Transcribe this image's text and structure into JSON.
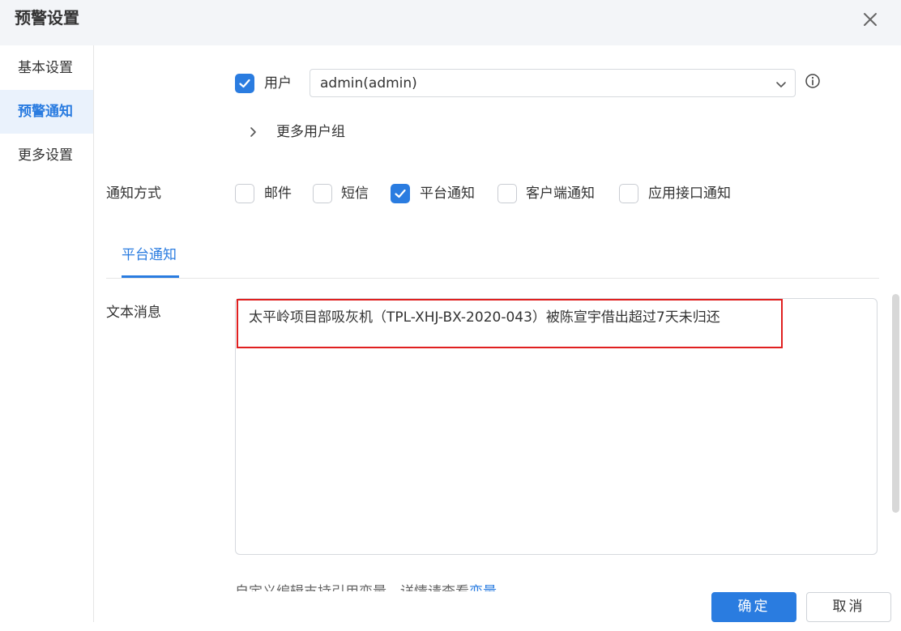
{
  "dialog": {
    "title": "预警设置"
  },
  "sidebar": {
    "items": [
      {
        "label": "基本设置"
      },
      {
        "label": "预警通知"
      },
      {
        "label": "更多设置"
      }
    ]
  },
  "recipients": {
    "user_label": "用户",
    "user_checked": true,
    "user_select_value": "admin(admin)",
    "more_groups_label": "更多用户组"
  },
  "notify": {
    "label": "通知方式",
    "options": [
      {
        "label": "邮件",
        "checked": false
      },
      {
        "label": "短信",
        "checked": false
      },
      {
        "label": "平台通知",
        "checked": true
      },
      {
        "label": "客户端通知",
        "checked": false
      },
      {
        "label": "应用接口通知",
        "checked": false
      }
    ]
  },
  "tabs": {
    "active": "平台通知"
  },
  "message": {
    "label": "文本消息",
    "text": "太平岭项目部吸灰机（TPL-XHJ-BX-2020-043）被陈宣宇借出超过7天未归还"
  },
  "hint": {
    "text": "自定义编辑支持引用变量，详情请查看",
    "link": "变量"
  },
  "footer": {
    "confirm": "确定",
    "cancel": "取消"
  },
  "colors": {
    "accent": "#2a7ce0",
    "highlight_border": "#e02020",
    "header_bg": "#f3f5f8"
  }
}
